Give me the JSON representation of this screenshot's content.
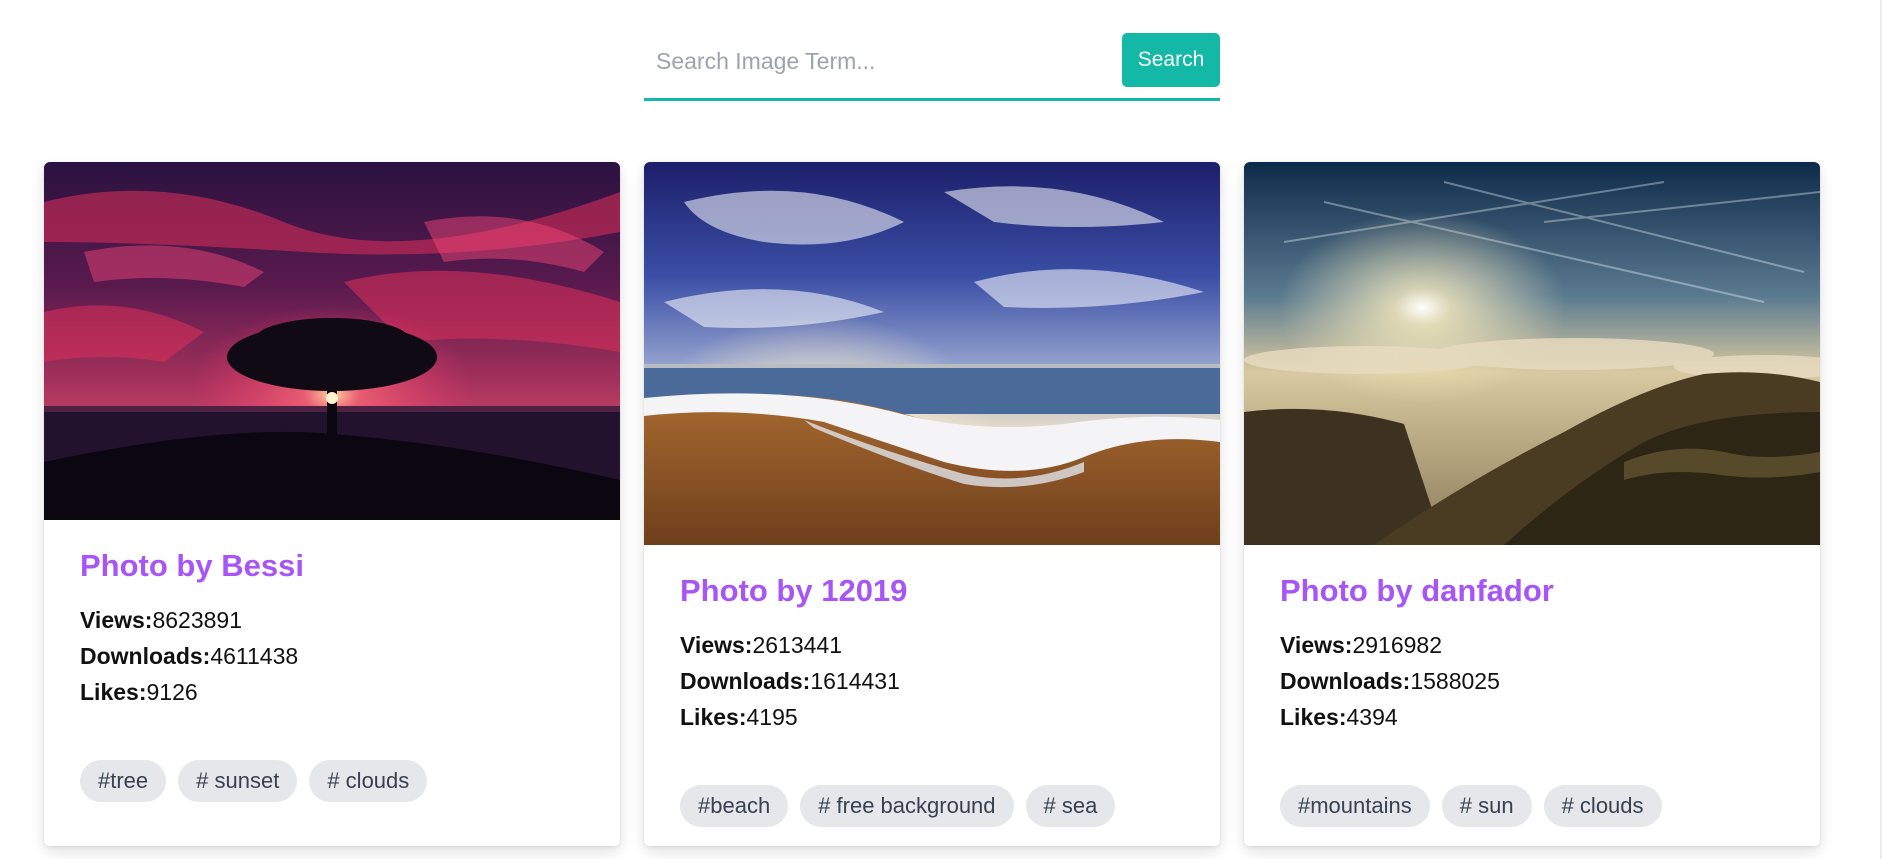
{
  "search": {
    "placeholder": "Search Image Term...",
    "value": "",
    "button_label": "Search"
  },
  "colors": {
    "accent": "#14b8a6",
    "title": "#a855f7",
    "tag_bg": "#e5e7eb"
  },
  "cards": [
    {
      "title": "Photo by Bessi",
      "views_label": "Views:",
      "views": "8623891",
      "downloads_label": "Downloads:",
      "downloads": "4611438",
      "likes_label": "Likes:",
      "likes": "9126",
      "tags": [
        "#tree",
        "# sunset",
        "# clouds"
      ]
    },
    {
      "title": "Photo by 12019",
      "views_label": "Views:",
      "views": "2613441",
      "downloads_label": "Downloads:",
      "downloads": "1614431",
      "likes_label": "Likes:",
      "likes": "4195",
      "tags": [
        "#beach",
        "# free background",
        "# sea"
      ]
    },
    {
      "title": "Photo by danfador",
      "views_label": "Views:",
      "views": "2916982",
      "downloads_label": "Downloads:",
      "downloads": "1588025",
      "likes_label": "Likes:",
      "likes": "4394",
      "tags": [
        "#mountains",
        "# sun",
        "# clouds"
      ]
    }
  ]
}
